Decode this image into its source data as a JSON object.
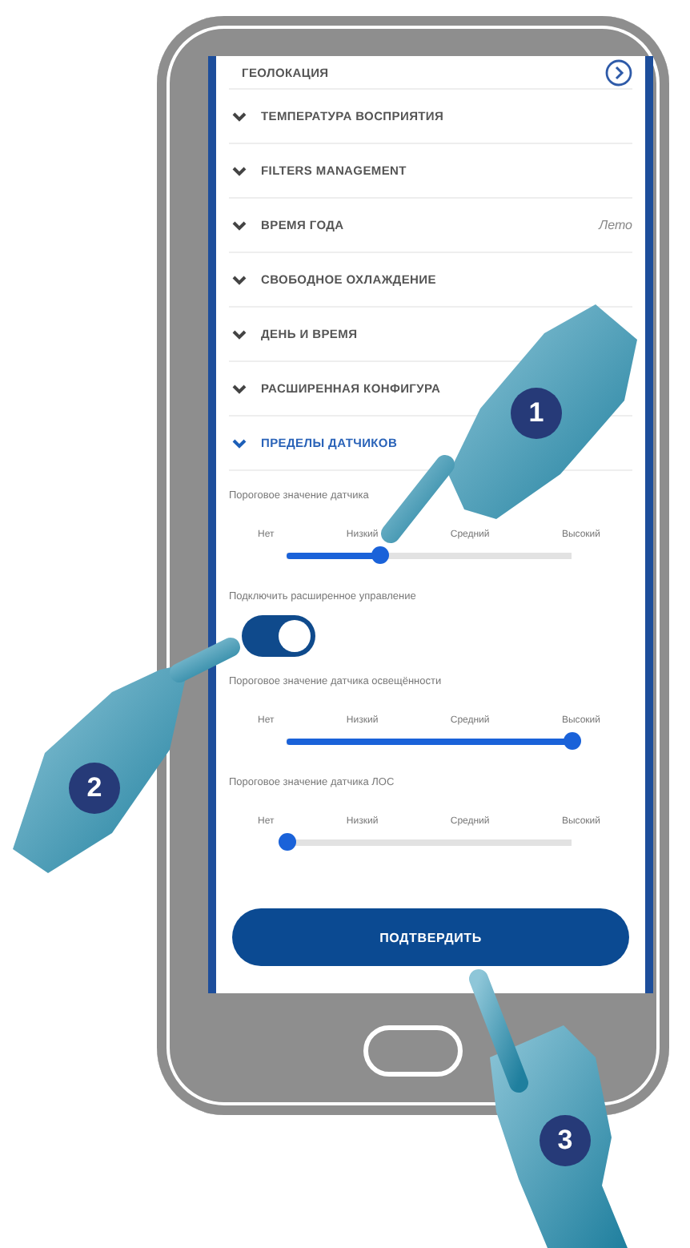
{
  "menu_items": [
    {
      "kind": "link",
      "label": "ГЕОЛОКАЦИЯ"
    },
    {
      "kind": "expand",
      "label": "ТЕМПЕРАТУРА ВОСПРИЯТИЯ",
      "expanded": false
    },
    {
      "kind": "expand",
      "label": "FILTERS MANAGEMENT",
      "expanded": false
    },
    {
      "kind": "expand",
      "label": "ВРЕМЯ ГОДА",
      "expanded": false,
      "value": "Лето"
    },
    {
      "kind": "expand",
      "label": "СВОБОДНОЕ ОХЛАЖДЕНИЕ",
      "expanded": false
    },
    {
      "kind": "expand",
      "label": "ДЕНЬ И ВРЕМЯ",
      "expanded": false
    },
    {
      "kind": "expand",
      "label": "РАСШИРЕННАЯ КОНФИГУРА",
      "expanded": false
    },
    {
      "kind": "expand",
      "label": "ПРЕДЕЛЫ ДАТЧИКОВ",
      "expanded": true
    }
  ],
  "settings": [
    {
      "kind": "slider",
      "label": "Пороговое значение датчика",
      "ticks": [
        "Нет",
        "Низкий",
        "Средний",
        "Высокий"
      ],
      "level": 0.33
    },
    {
      "kind": "toggle",
      "label": "Подключить расширенное управление",
      "on": true
    },
    {
      "kind": "slider",
      "label": "Пороговое значение датчика освещённости",
      "ticks": [
        "Нет",
        "Низкий",
        "Средний",
        "Высокий"
      ],
      "level": 1
    },
    {
      "kind": "slider",
      "label": "Пороговое значение датчика ЛОС",
      "ticks": [
        "Нет",
        "Низкий",
        "Средний",
        "Высокий"
      ],
      "level": 0
    }
  ],
  "confirm_button": "ПОДТВЕРДИТЬ",
  "steps": [
    "1",
    "2",
    "3"
  ]
}
